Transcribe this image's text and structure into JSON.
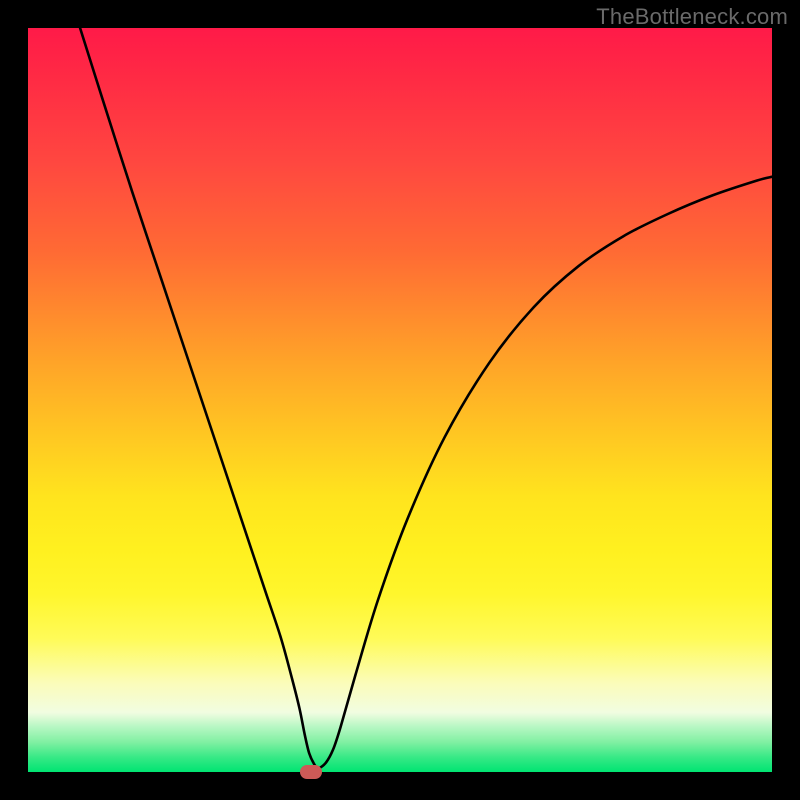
{
  "watermark": "TheBottleneck.com",
  "colors": {
    "frame": "#000000",
    "curve": "#000000",
    "marker": "#cc5a57",
    "gradient_top": "#ff1a48",
    "gradient_bottom": "#00e472"
  },
  "chart_data": {
    "type": "line",
    "title": "",
    "xlabel": "",
    "ylabel": "",
    "xlim": [
      0,
      100
    ],
    "ylim": [
      0,
      100
    ],
    "annotations": [
      {
        "name": "minimum-marker",
        "x": 38,
        "y": 0
      }
    ],
    "series": [
      {
        "name": "bottleneck-curve",
        "x": [
          7,
          10,
          14,
          18,
          22,
          26,
          30,
          32,
          34,
          35.5,
          36.5,
          37.2,
          37.8,
          38.5,
          39,
          40,
          41,
          42,
          44,
          47,
          51,
          56,
          62,
          68,
          74,
          80,
          86,
          92,
          98,
          100
        ],
        "y": [
          100,
          90.5,
          78,
          66,
          54,
          42,
          30,
          24,
          18,
          12.5,
          8.5,
          5,
          2.5,
          1,
          0.5,
          1.2,
          3,
          6,
          13,
          23,
          34,
          45,
          55,
          62.5,
          68,
          72,
          75,
          77.5,
          79.5,
          80
        ]
      }
    ]
  }
}
